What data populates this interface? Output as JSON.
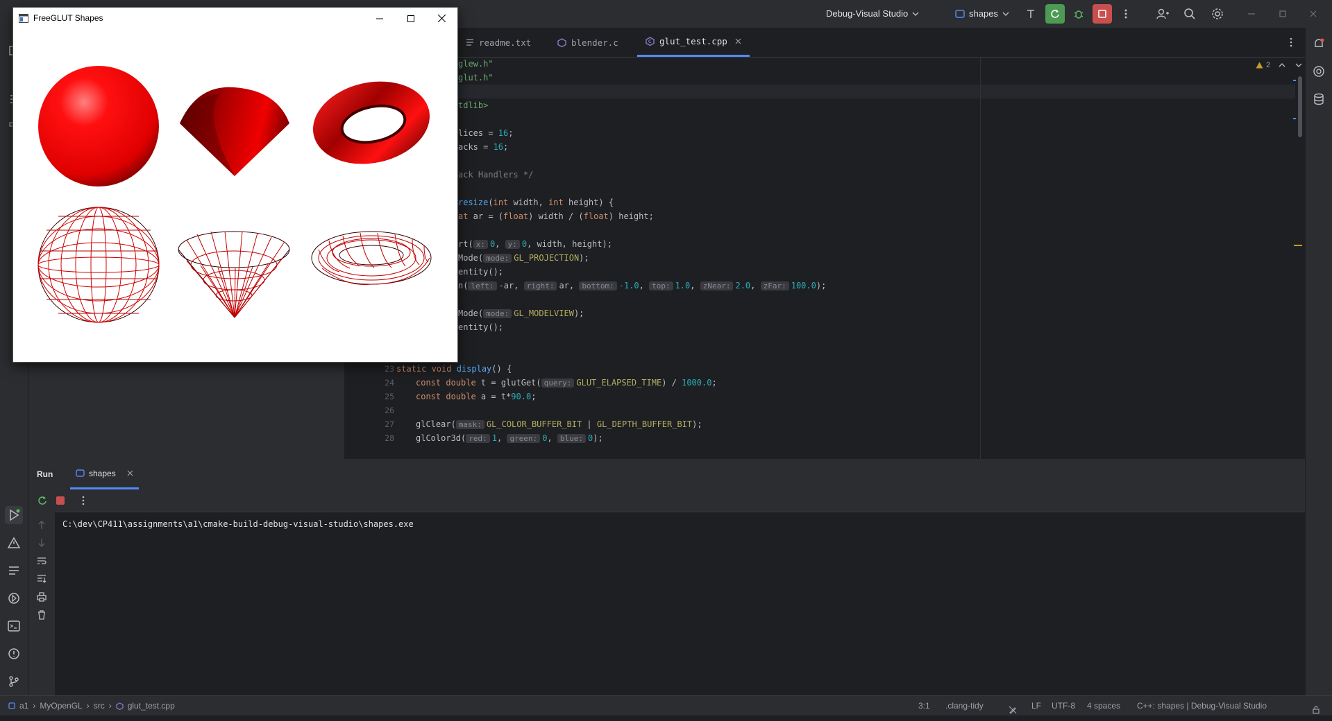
{
  "ide": {
    "run_config": "Debug-Visual Studio",
    "target": "shapes"
  },
  "tabs": [
    {
      "label": "readme.txt",
      "icon": "text-file-icon"
    },
    {
      "label": "blender.c",
      "icon": "c-file-icon"
    },
    {
      "label": "glut_test.cpp",
      "icon": "cpp-file-icon",
      "active": true
    }
  ],
  "editor": {
    "warnings_count": "2",
    "lines": [
      {
        "no": "23",
        "code": "static void display() {"
      },
      {
        "no": "24",
        "code": "const double t = glutGet(query: GLUT_ELAPSED_TIME) / 1000.0;"
      },
      {
        "no": "25",
        "code": "const double a = t*90.0;"
      },
      {
        "no": "26",
        "code": ""
      },
      {
        "no": "27",
        "code": "glClear(mask: GL_COLOR_BUFFER_BIT | GL_DEPTH_BUFFER_BIT);"
      },
      {
        "no": "28",
        "code": "glColor3d(red: 1, green: 0, blue: 0);"
      }
    ],
    "fragments": {
      "l1": "glew.h\"",
      "l2": "glut.h\"",
      "l4": "tdlib>",
      "l6a": "lices = ",
      "l6b": "16",
      "l6c": ";",
      "l7a": "acks = ",
      "l7b": "16",
      "l7c": ";",
      "l9": "ack Handlers */",
      "l11a": "resize",
      "l11b": "(",
      "l11c": "int",
      "l11d": " width, ",
      "l11e": "int",
      "l11f": " height) {",
      "l12a": "at",
      "l12b": " ar = (",
      "l12c": "float",
      "l12d": ") width / (",
      "l12e": "float",
      "l12f": ") height;",
      "l14a": "rt(",
      "l14h1": "x:",
      "l14b": "0",
      "l14c": ", ",
      "l14h2": "y:",
      "l14d": "0",
      "l14e": ", width, height);",
      "l15a": "Mode(",
      "l15h": "mode:",
      "l15b": "GL_PROJECTION",
      "l15c": ");",
      "l16": "entity();",
      "l17a": "n(",
      "l17h1": "left:",
      "l17b": "-ar, ",
      "l17h2": "right:",
      "l17c": "ar, ",
      "l17h3": "bottom:",
      "l17d": "-1.0",
      "l17e": ", ",
      "l17h4": "top:",
      "l17f": "1.0",
      "l17g": ", ",
      "l17h5": "zNear:",
      "l17i": "2.0",
      "l17j": ", ",
      "l17h6": "zFar:",
      "l17k": "100.0",
      "l17l": ");",
      "l19a": "Mode(",
      "l19h": "mode:",
      "l19b": "GL_MODELVIEW",
      "l19c": ");",
      "l20": "entity();",
      "l23a": "static void ",
      "l23b": "display",
      "l23c": "() {",
      "l24a": "const double",
      "l24b": " t = glutGet(",
      "l24h": "query:",
      "l24c": "GLUT_ELAPSED_TIME",
      "l24d": ") / ",
      "l24e": "1000.0",
      "l24f": ";",
      "l25a": "const double",
      "l25b": " a = t*",
      "l25c": "90.0",
      "l25d": ";",
      "l27a": "glClear(",
      "l27h": "mask:",
      "l27b": "GL_COLOR_BUFFER_BIT",
      "l27c": " | ",
      "l27d": "GL_DEPTH_BUFFER_BIT",
      "l27e": ");",
      "l28a": "glColor3d(",
      "l28h1": "red:",
      "l28b": "1",
      "l28c": ", ",
      "l28h2": "green:",
      "l28d": "0",
      "l28e": ", ",
      "l28h3": "blue:",
      "l28f": "0",
      "l28g": ");"
    }
  },
  "run_panel": {
    "title": "Run",
    "tab_label": "shapes",
    "output": "C:\\dev\\CP411\\assignments\\a1\\cmake-build-debug-visual-studio\\shapes.exe"
  },
  "statusbar": {
    "breadcrumb": [
      "a1",
      "MyOpenGL",
      "src",
      "glut_test.cpp"
    ],
    "position": "3:1",
    "linter": ".clang-tidy",
    "line_ending": "LF",
    "encoding": "UTF-8",
    "indent": "4 spaces",
    "context": "C++: shapes | Debug-Visual Studio"
  },
  "glut_window": {
    "title": "FreeGLUT Shapes",
    "shapes": [
      "solid-sphere",
      "solid-cone",
      "solid-torus",
      "wire-sphere",
      "wire-cone",
      "wire-torus"
    ],
    "shape_color": "#ff0000"
  },
  "colors": {
    "accent": "#548af7",
    "run_green": "#4c9a54",
    "stop_red": "#e05555"
  }
}
